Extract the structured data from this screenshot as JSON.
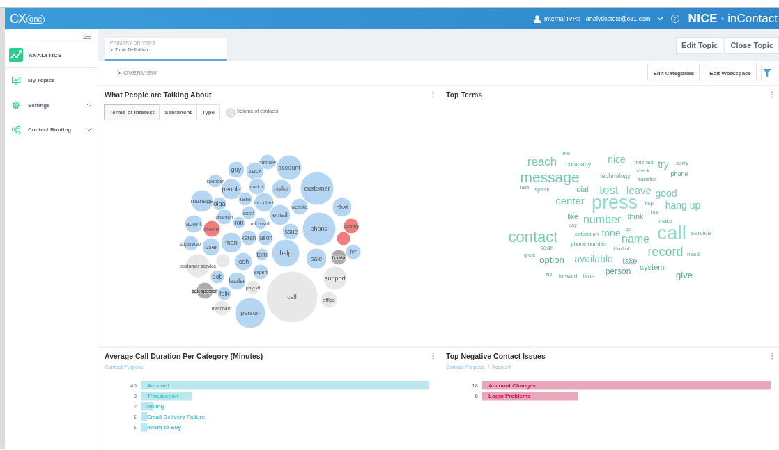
{
  "header": {
    "logo": {
      "main": "CX",
      "cloud": "one"
    },
    "user": "Internal IVRs · analyticstest@c31.com",
    "help": "?",
    "brand": {
      "bold": "NICE",
      "light": "inContact"
    }
  },
  "sidebar": {
    "module": "ANALYTICS",
    "items": [
      {
        "label": "My Topics",
        "kind": "link"
      },
      {
        "label": "Settings",
        "kind": "group"
      },
      {
        "label": "Contact Routing",
        "kind": "group"
      }
    ]
  },
  "topic_tab": {
    "overline": "PRIMARY DRIVERS",
    "label": "Topic Definition",
    "selected": true
  },
  "topic_buttons": [
    "Edit Topic",
    "Close Topic"
  ],
  "overview": {
    "label": "OVERVIEW",
    "buttons": [
      "Edit Categories",
      "Edit Workspace"
    ]
  },
  "talking": {
    "title": "What People are Talking About",
    "tabs": [
      {
        "label": "Terms of Interest",
        "selected": true
      },
      {
        "label": "Sentiment",
        "selected": false
      },
      {
        "label": "Type",
        "selected": false
      }
    ],
    "legend": "Volume of contacts",
    "bubbles": [
      {
        "label": "anthony",
        "color": "#b5d6f3"
      },
      {
        "label": "account",
        "color": "#b5d6f3"
      },
      {
        "label": "guy",
        "color": "#b5d6f3"
      },
      {
        "label": "zack",
        "color": "#b5d6f3"
      },
      {
        "label": "spencer",
        "color": "#b5d6f3"
      },
      {
        "label": "people",
        "color": "#b5d6f3"
      },
      {
        "label": "carlos",
        "color": "#b5d6f3"
      },
      {
        "label": "dollar",
        "color": "#b5d6f3"
      },
      {
        "label": "customer",
        "color": "#b5d6f3"
      },
      {
        "label": "manage",
        "color": "#b5d6f3"
      },
      {
        "label": "olga",
        "color": "#b5d6f3"
      },
      {
        "label": "ram",
        "color": "#b5d6f3"
      },
      {
        "label": "incontact",
        "color": "#b5d6f3"
      },
      {
        "label": "website",
        "color": "#b5d6f3"
      },
      {
        "label": "chat",
        "color": "#b5d6f3"
      },
      {
        "label": "agent",
        "color": "#b5d6f3"
      },
      {
        "label": "charlton",
        "color": "#b5d6f3"
      },
      {
        "label": "scott",
        "color": "#b5d6f3"
      },
      {
        "label": "email",
        "color": "#b5d6f3"
      },
      {
        "label": "director",
        "color": "#f47c7c"
      },
      {
        "label": "ron",
        "color": "#b5d6f3"
      },
      {
        "label": "microsoft",
        "color": "#b5d6f3"
      },
      {
        "label": "issue",
        "color": "#b5d6f3"
      },
      {
        "label": "phone",
        "color": "#b5d6f3"
      },
      {
        "label": "country",
        "color": "#f47c7c"
      },
      {
        "color": "#f47c7c"
      },
      {
        "label": "supervisor",
        "color": "#b5d6f3"
      },
      {
        "label": "user",
        "color": "#b5d6f3"
      },
      {
        "label": "man",
        "color": "#b5d6f3"
      },
      {
        "label": "karen",
        "color": "#b5d6f3"
      },
      {
        "label": "jason",
        "color": "#b5d6f3"
      },
      {
        "label": "help",
        "color": "#b5d6f3"
      },
      {
        "label": "sale",
        "color": "#b5d6f3"
      },
      {
        "label": "florida",
        "color": "#ababab"
      },
      {
        "label": "ivr",
        "color": "#b5d6f3"
      },
      {
        "label": "customer service",
        "color": "#e8e8e8"
      },
      {
        "color": "#e8e8e8"
      },
      {
        "label": "josh",
        "color": "#b5d6f3"
      },
      {
        "label": "tom",
        "color": "#b5d6f3"
      },
      {
        "label": "expert",
        "color": "#b5d6f3"
      },
      {
        "label": "bob",
        "color": "#b5d6f3"
      },
      {
        "label": "leader",
        "color": "#b5d6f3"
      },
      {
        "label": "paypal",
        "color": "#e8e8e8"
      },
      {
        "label": "support",
        "color": "#e8e8e8"
      },
      {
        "label": "salesperson",
        "color": "#ababab"
      },
      {
        "label": "folk",
        "color": "#b5d6f3"
      },
      {
        "label": "call",
        "color": "#e8e8e8"
      },
      {
        "label": "office",
        "color": "#e8e8e8"
      },
      {
        "label": "merchant",
        "color": "#e8e8e8"
      },
      {
        "label": "person",
        "color": "#b5d6f3"
      }
    ]
  },
  "top_terms": {
    "title": "Top Terms",
    "terms": [
      "line",
      "reach",
      "company",
      "nice",
      "finished",
      "try",
      "sorry",
      "check",
      "message",
      "technology",
      "transfer",
      "phone",
      "last",
      "speak",
      "dial",
      "test",
      "leave",
      "good",
      "center",
      "press",
      "help",
      "hang up",
      "talk",
      "like",
      "number",
      "think",
      "make",
      "contact",
      "day",
      "go",
      "extension",
      "tone",
      "call",
      "service",
      "name",
      "phone number",
      "soon",
      "kind of",
      "great",
      "record",
      "need",
      "option",
      "available",
      "take",
      "system",
      "No.",
      "forward",
      "time",
      "person",
      "give"
    ]
  },
  "duration": {
    "title": "Average Call Duration Per Category (Minutes)",
    "breadcrumb": [
      "Contact Purpose"
    ],
    "chart_data": {
      "type": "bar",
      "orientation": "horizontal",
      "categories": [
        "Account",
        "Transaction",
        "Billing",
        "Email Delivery Failure",
        "Intent to Buy"
      ],
      "series": [
        {
          "color": "#bce7ec",
          "values": [
            45,
            8,
            2,
            1,
            1
          ]
        }
      ],
      "data_labels": true
    }
  },
  "negative": {
    "title": "Top Negative Contact Issues",
    "breadcrumb": [
      "Contact Purpose",
      "Account"
    ],
    "breadcrumb_separator": "/",
    "chart_data": {
      "type": "bar",
      "orientation": "horizontal",
      "categories": [
        "Account Changes",
        "Login Problems"
      ],
      "series": [
        {
          "color": "#e8a7bb",
          "values": [
            18,
            6
          ]
        }
      ],
      "data_labels": true
    }
  }
}
